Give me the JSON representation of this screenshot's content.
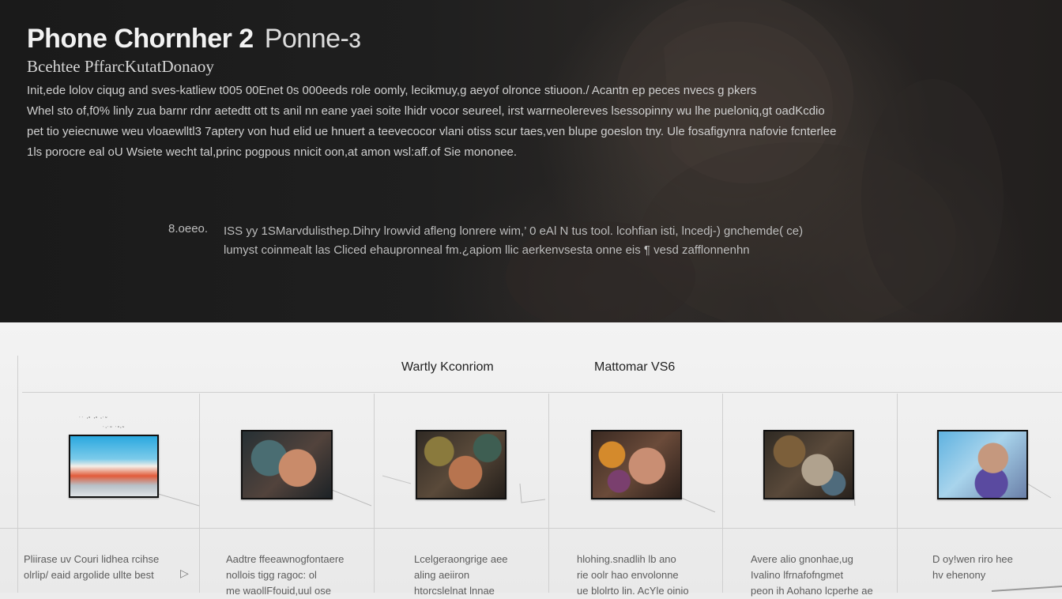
{
  "hero": {
    "title": "Phone Chornher 2",
    "title_suffix": "Ponne-ɜ",
    "subtitle": "Bcehtee PffarcKutatDonaoy",
    "paragraph": [
      "Init,ede lolov ciqug and sves-katliew t005 00Enet 0s 000eeds role oomly, lecikmuy,g aeyof olronce stiuoon./  Acantn ep peces nvecs g pkers",
      "Whel sto of,f0% linly zua barnr rdnr aetedtt ott ts anil nn eane yaei soite lhidr vocor seureel, irst warrneolereves  lsessopinny wu lhe pueloniq,gt oadKcdio",
      "pet tio yeiecnuwe weu vloaewlltl3 7aptery von hud elid ue hnuert a teevecocor vlani otiss scur taes,ven blupe goeslon tny.  Ule fosafigynra nafovie fcnterlee",
      " 1ls porocre eal oU Wsiete wecht tal,princ pogpous nnicit oon,at amon  wsl:aff.of Sie mononee."
    ],
    "meta_key": "8.oeeo.",
    "meta_lines": [
      "ISS yy  1SMarvdulisthep.Dihry lrowvid afleng lonrere wim,’ 0 eAl N tus tool. lcohfian isti, lncedj-) gnchemde( ce)",
      "lumyst coinmealt las Cliced ehaupronneal fm.¿apiom  llic aerkenvsesta onne eis  ¶ vesd zafflonnenhn"
    ]
  },
  "strip": {
    "header_left": "Wartly  Kconriom",
    "header_right": "Mattomar VS6",
    "tiny_label_1": "˙˙ ‘˚ ’˚ ‘˙˜",
    "tiny_label_2": "˙‘˙˜ ˙˚‘˜",
    "cells": [
      {
        "thumb": "gradient-thumbnail",
        "caption": [
          "Pliirase uv  Couri lidhea  rcihse",
          "olrlip/ eaid argolide ullte best"
        ]
      },
      {
        "thumb": "photo-thumbnail",
        "caption": [
          "Aadtre ffeeawnogfontaere",
          "nollois tigg  ragoc: ol",
          "me waollFfouid,uul ose"
        ]
      },
      {
        "thumb": "photo-thumbnail",
        "caption": [
          "Lcelgeraongrige aee",
          "aling  aeiiron",
          "htorcslelnat lnnae"
        ]
      },
      {
        "thumb": "photo-thumbnail",
        "caption": [
          "hlohing.snadlih lb ano",
          "rie oolr hao envolonne",
          "ue blolrto lin. AcYle oinio"
        ]
      },
      {
        "thumb": "photo-thumbnail",
        "caption": [
          "Avere alio gnonhae,ug",
          "Ivalino lfrnafofngmet",
          "peon ih Aohano lcperhe ae"
        ]
      },
      {
        "thumb": "photo-thumbnail",
        "caption": [
          "D oy!wen riro hee",
          "hv ehenony"
        ]
      }
    ]
  },
  "colors": {
    "hero_bg": "#1f1f1f",
    "strip_bg": "#ececec",
    "title_text": "#f2f2f2",
    "thumb_border": "#111111"
  }
}
